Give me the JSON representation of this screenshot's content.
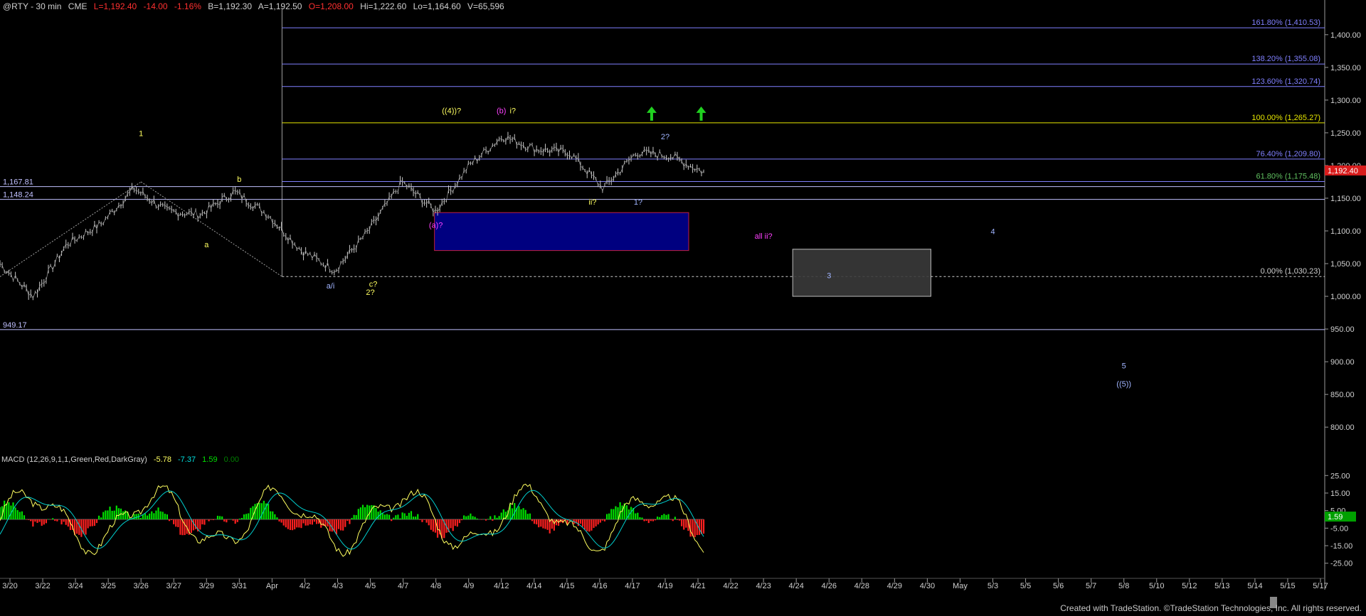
{
  "header": {
    "symbol": "@RTY - 30 min",
    "exchange": "CME",
    "last": "L=1,192.40",
    "change": "-14.00",
    "change_pct": "-1.16%",
    "bid": "B=1,192.30",
    "ask": "A=1,192.50",
    "open": "O=1,208.00",
    "high": "Hi=1,222.60",
    "low": "Lo=1,164.60",
    "volume": "V=65,596"
  },
  "macd_header": {
    "label": "MACD (12,26,9,1,1,Green,Red,DarkGray)",
    "v1": "-5.78",
    "v2": "-7.37",
    "v3": "1.59",
    "v4": "0.00"
  },
  "credit": "Created with TradeStation. ©TradeStation Technologies, Inc. All rights reserved.",
  "colors": {
    "up": "#00e000",
    "down": "#ff2020",
    "price_bar": "#c8c8c8",
    "fib": "#8080ff",
    "fib_100": "#e6e600",
    "wave_yellow": "#ffff60",
    "wave_magenta": "#ff40ff",
    "wave_lightblue": "#a0b4ff",
    "current_price_bg": "#d81c1c"
  },
  "chart_data": {
    "type": "line",
    "x": [
      "3/20",
      "3/22",
      "3/24",
      "3/25",
      "3/26",
      "3/27",
      "3/29",
      "3/31",
      "Apr",
      "4/2",
      "4/3",
      "4/5",
      "4/7",
      "4/8",
      "4/9",
      "4/12",
      "4/14",
      "4/15",
      "4/16",
      "4/17",
      "4/19",
      "4/21",
      "4/22",
      "4/23",
      "4/24",
      "4/26",
      "4/28",
      "4/29",
      "4/30",
      "May",
      "5/3",
      "5/5",
      "5/6",
      "5/7",
      "5/8",
      "5/10",
      "5/12",
      "5/13",
      "5/14",
      "5/15",
      "5/17"
    ],
    "series": [
      {
        "values": [
          1050,
          1000,
          1080,
          1110,
          1165,
          1130,
          1125,
          1160,
          1125,
          1070,
          1040,
          1100,
          1175,
          1130,
          1200,
          1245,
          1225,
          1220,
          1165,
          1220,
          1215,
          1190
        ]
      }
    ],
    "yticks": [
      "800.00",
      "850.00",
      "900.00",
      "950.00",
      "1,000.00",
      "1,050.00",
      "1,100.00",
      "1,150.00",
      "1,200.00",
      "1,250.00",
      "1,300.00",
      "1,350.00",
      "1,400.00"
    ],
    "ylim": [
      760,
      1440
    ],
    "current_price": "1,192.40",
    "horizontal_levels": [
      {
        "value": 1167.81,
        "label": "1,167.81"
      },
      {
        "value": 1148.24,
        "label": "1,148.24"
      },
      {
        "value": 949.17,
        "label": "949.17"
      }
    ],
    "fib_levels": [
      {
        "value": 1410.53,
        "label": "161.80% (1,410.53)"
      },
      {
        "value": 1355.08,
        "label": "138.20% (1,355.08)"
      },
      {
        "value": 1320.74,
        "label": "123.60% (1,320.74)"
      },
      {
        "value": 1265.27,
        "label": "100.00% (1,265.27)"
      },
      {
        "value": 1209.8,
        "label": "76.40% (1,209.80)"
      },
      {
        "value": 1175.48,
        "label": "61.80% (1,175.48)"
      },
      {
        "value": 1030.23,
        "label": "0.00% (1,030.23)"
      }
    ],
    "wave_labels": [
      {
        "text": "1",
        "x": "3/26",
        "y": 1245,
        "color": "wave_yellow"
      },
      {
        "text": "b",
        "x": "3/31",
        "y": 1175,
        "color": "wave_yellow"
      },
      {
        "text": "a",
        "x": "3/29",
        "y": 1075,
        "color": "wave_yellow"
      },
      {
        "text": "a/i",
        "x": "4/3",
        "y": 1012,
        "color": "wave_lightblue"
      },
      {
        "text": "c?",
        "x": "4/5",
        "y": 1015,
        "color": "wave_yellow"
      },
      {
        "text": "2?",
        "x": "4/5",
        "y": 1002,
        "color": "wave_yellow"
      },
      {
        "text": "(a)?",
        "x": "4/8",
        "y": 1105,
        "color": "wave_magenta"
      },
      {
        "text": "((4))?",
        "x": "4/9",
        "y": 1280,
        "color": "wave_yellow"
      },
      {
        "text": "(b)",
        "x": "4/12",
        "y": 1280,
        "color": "wave_magenta"
      },
      {
        "text": "i?",
        "x": "4/12",
        "y": 1280,
        "color": "wave_yellow"
      },
      {
        "text": "ii?",
        "x": "4/16",
        "y": 1140,
        "color": "wave_yellow"
      },
      {
        "text": "1?",
        "x": "4/17",
        "y": 1140,
        "color": "wave_lightblue"
      },
      {
        "text": "2?",
        "x": "4/19",
        "y": 1240,
        "color": "wave_lightblue"
      },
      {
        "text": "all ii?",
        "x": "4/23",
        "y": 1088,
        "color": "wave_magenta"
      },
      {
        "text": "3",
        "x": "4/26",
        "y": 1028,
        "color": "wave_lightblue"
      },
      {
        "text": "4",
        "x": "5/3",
        "y": 1095,
        "color": "wave_lightblue"
      },
      {
        "text": "5",
        "x": "5/8",
        "y": 890,
        "color": "wave_lightblue"
      },
      {
        "text": "((5))",
        "x": "5/8",
        "y": 862,
        "color": "wave_lightblue"
      }
    ],
    "macd": {
      "yticks": [
        "25.00",
        "15.00",
        "5.00",
        "-5.00",
        "-15.00",
        "-25.00"
      ],
      "ylim": [
        -32,
        32
      ],
      "current_label": "1.59"
    }
  }
}
